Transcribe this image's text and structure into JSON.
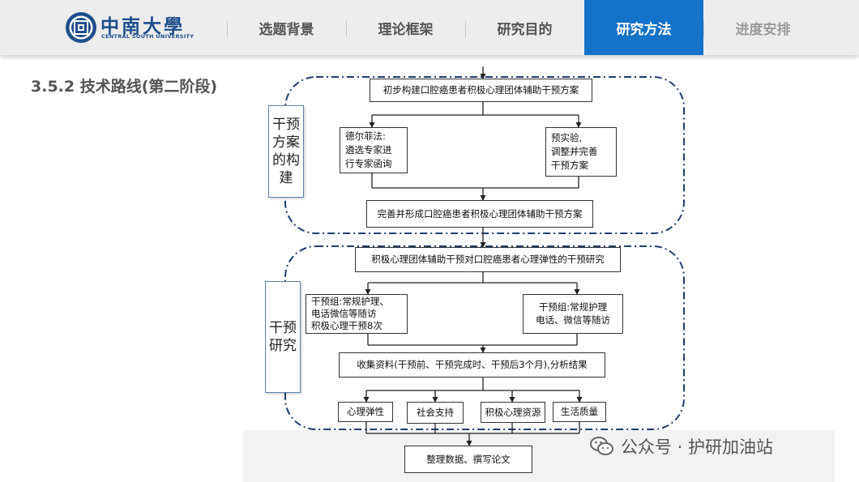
{
  "header": {
    "logo": {
      "name_cn": "中南大學",
      "name_en": "CENTRAL SOUTH UNIVERSITY"
    },
    "nav": [
      {
        "label": "选题背景",
        "active": false
      },
      {
        "label": "理论框架",
        "active": false
      },
      {
        "label": "研究目的",
        "active": false
      },
      {
        "label": "研究方法",
        "active": true
      },
      {
        "label": "进度安排",
        "active": false
      }
    ],
    "accent_color": "#1473c9"
  },
  "section": {
    "title": "3.5.2   技术路线(第二阶段)"
  },
  "flowchart": {
    "phase1": {
      "label": "干预方案的构建",
      "top": "初步构建口腔癌患者积极心理团体辅助干预方案",
      "left": [
        "德尔菲法:",
        "遴选专家进",
        "行专家函询"
      ],
      "right": [
        "预实验,",
        "调整并完善",
        "干预方案"
      ],
      "bottom": "完善并形成口腔癌患者积极心理团体辅助干预方案"
    },
    "phase2": {
      "label": "干预研究",
      "top": "积极心理团体辅助干预对口腔癌患者心理弹性的干预研究",
      "left": [
        "干预组:常规护理、",
        "电话微信等随访",
        "积极心理干预8次"
      ],
      "right": [
        "干预组:常规护理",
        "电话、微信等随访"
      ],
      "collect": "收集资料(干预前、干预完成时、干预后3个月),分析结果",
      "outcomes": [
        "心理弹性",
        "社会支持",
        "积极心理资源",
        "生活质量"
      ]
    },
    "final": "整理数据、撰写论文"
  },
  "watermark": {
    "text": "公众号 · 护研加油站",
    "icon": "wechat-icon"
  }
}
